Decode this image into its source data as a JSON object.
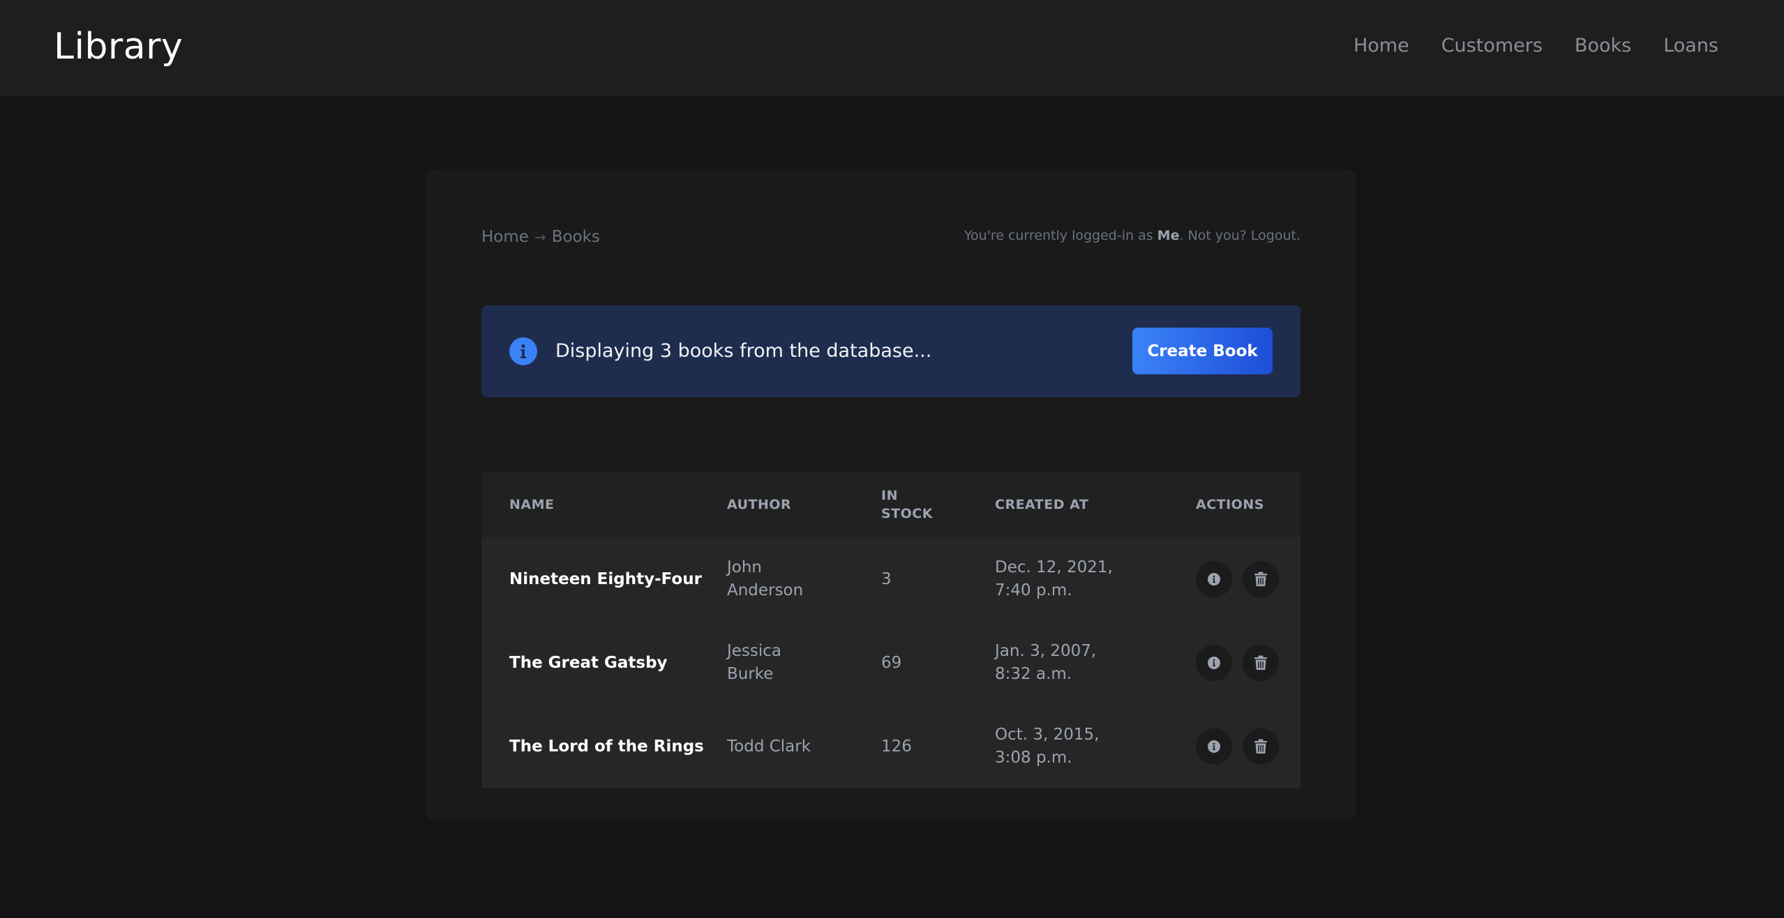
{
  "header": {
    "brand": "Library",
    "nav": [
      "Home",
      "Customers",
      "Books",
      "Loans"
    ]
  },
  "breadcrumb": {
    "items": [
      "Home",
      "Books"
    ],
    "separator": "→"
  },
  "login_status": {
    "prefix": "You're currently logged-in as ",
    "user": "Me",
    "middle": ". Not you? ",
    "logout": "Logout."
  },
  "alert": {
    "message": "Displaying 3 books from the database...",
    "button": "Create Book"
  },
  "table": {
    "columns": [
      "Name",
      "Author",
      "In Stock",
      "Created At",
      "Actions"
    ],
    "rows": [
      {
        "name": "Nineteen Eighty-Four",
        "author": "John Anderson",
        "stock": "3",
        "created": "Dec. 12, 2021, 7:40 p.m."
      },
      {
        "name": "The Great Gatsby",
        "author": "Jessica Burke",
        "stock": "69",
        "created": "Jan. 3, 2007, 8:32 a.m."
      },
      {
        "name": "The Lord of the Rings",
        "author": "Todd Clark",
        "stock": "126",
        "created": "Oct. 3, 2015, 3:08 p.m."
      }
    ]
  },
  "icons": {
    "alert": "info-circle-icon",
    "row_info": "info-icon",
    "row_delete": "trash-icon"
  },
  "colors": {
    "background": "#141414",
    "header": "#1e1e1e",
    "card": "#1a1a1a",
    "alert_bg": "#1e2c4e",
    "accent": "#3b82f6",
    "accent_dark": "#1d4ed8"
  }
}
